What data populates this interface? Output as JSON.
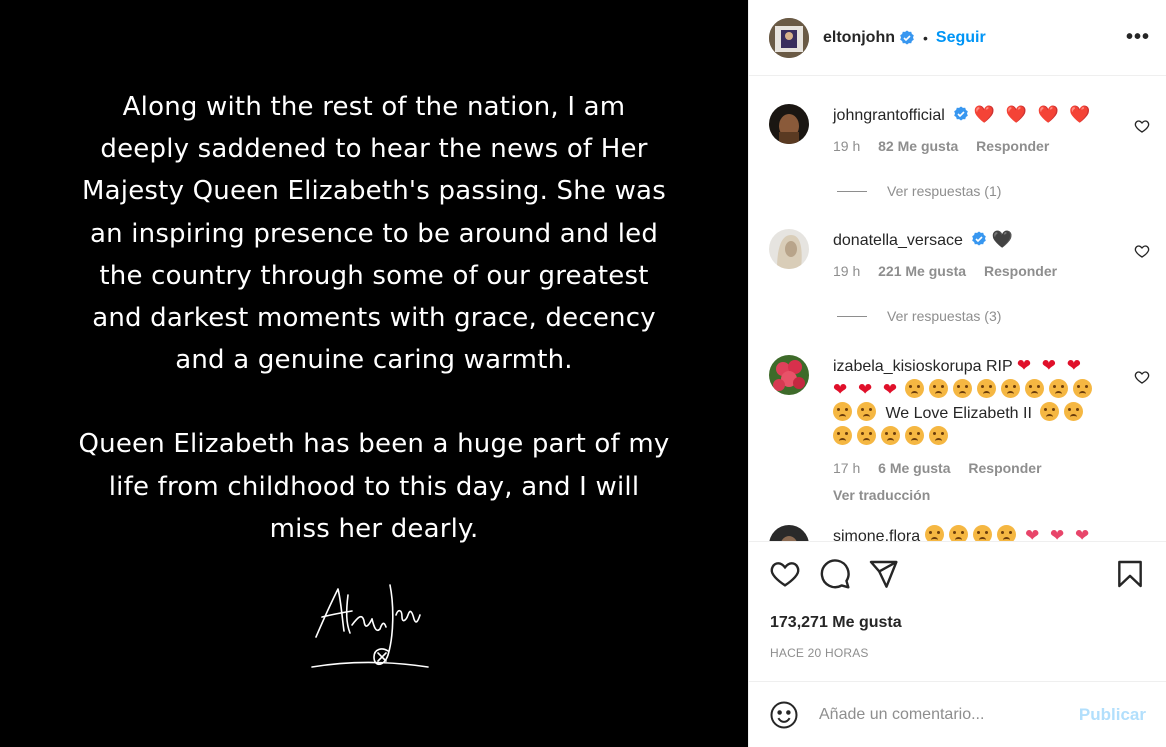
{
  "post": {
    "paragraph1": "Along with the rest of the nation, I am deeply saddened to hear the news of Her Majesty Queen Elizabeth's passing. She was an inspiring presence to be around and led the country through some of our greatest and darkest moments with grace, decency and a genuine caring warmth.",
    "paragraph2": "Queen Elizabeth has been a huge part of my life from childhood to this day, and I will miss her dearly.",
    "signature_text": "Elton John"
  },
  "header": {
    "username": "eltonjohn",
    "separator": "•",
    "follow_label": "Seguir",
    "more_label": "•••"
  },
  "comments": [
    {
      "username": "johngrantofficial",
      "verified": true,
      "text": "❤️ ❤️ ❤️ ❤️",
      "time": "19 h",
      "likes": "82 Me gusta",
      "reply": "Responder",
      "replies_label": "Ver respuestas (1)"
    },
    {
      "username": "donatella_versace",
      "verified": true,
      "text": "🖤",
      "time": "19 h",
      "likes": "221 Me gusta",
      "reply": "Responder",
      "replies_label": "Ver respuestas (3)"
    },
    {
      "username": "izabela_kisioskorupa",
      "verified": false,
      "text_prefix": "RIP",
      "text_middle": "We Love Elizabeth II",
      "time": "17 h",
      "likes": "6 Me gusta",
      "reply": "Responder",
      "translate": "Ver traducción"
    },
    {
      "username": "simone.flora",
      "verified": false
    }
  ],
  "actions": {
    "likes_total": "173,271 Me gusta",
    "time_ago": "HACE 20 HORAS"
  },
  "comment_box": {
    "placeholder": "Añade un comentario...",
    "publish_label": "Publicar"
  },
  "colors": {
    "accent": "#0095f6",
    "publish_disabled": "#b2dffc",
    "heart_red": "#e0102a",
    "muted": "#8e8e8e"
  }
}
